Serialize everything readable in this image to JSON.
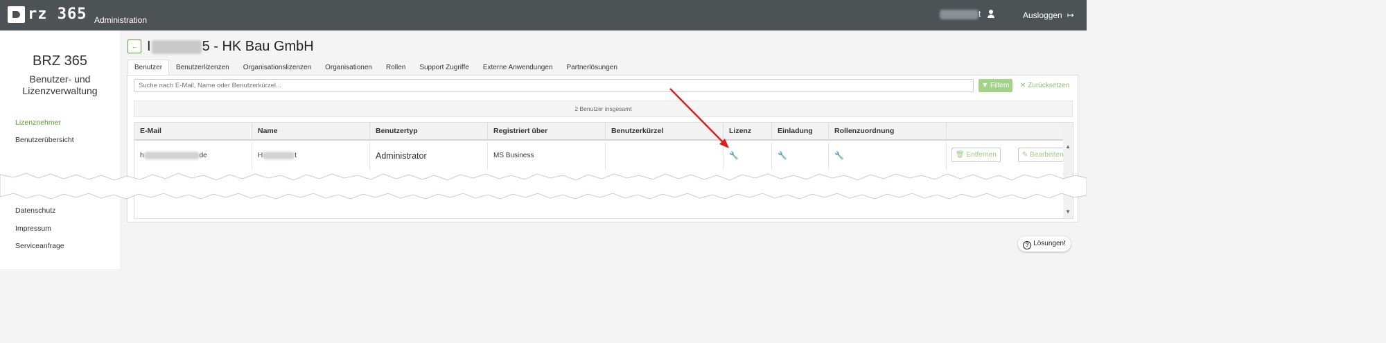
{
  "header": {
    "logo_text": "rz 365",
    "admin_label": "Administration",
    "user_suffix": "t",
    "logout_label": "Ausloggen",
    "logout_icon": "sign-out-icon"
  },
  "sidebar": {
    "title": "BRZ 365",
    "subtitle": "Benutzer- und Lizenzverwaltung",
    "items": [
      {
        "label": "Lizenznehmer",
        "active": true
      },
      {
        "label": "Benutzerübersicht",
        "active": false
      },
      {
        "label": "Datenschutz",
        "active": false
      },
      {
        "label": "Impressum",
        "active": false
      },
      {
        "label": "Serviceanfrage",
        "active": false
      }
    ]
  },
  "page": {
    "back_icon": "arrow-left-icon",
    "title_prefix": "I",
    "title_suffix": "5 - HK Bau GmbH"
  },
  "tabs": [
    {
      "label": "Benutzer",
      "active": true
    },
    {
      "label": "Benutzerlizenzen"
    },
    {
      "label": "Organisationslizenzen"
    },
    {
      "label": "Organisationen"
    },
    {
      "label": "Rollen"
    },
    {
      "label": "Support Zugriffe"
    },
    {
      "label": "Externe Anwendungen"
    },
    {
      "label": "Partnerlösungen"
    }
  ],
  "search": {
    "placeholder": "Suche nach E-Mail, Name oder Benutzerkürzel...",
    "filter_label": "Filtern",
    "reset_label": "Zurücksetzen"
  },
  "count_text": "2 Benutzer insgesamt",
  "table": {
    "columns": [
      "E-Mail",
      "Name",
      "Benutzertyp",
      "Registriert über",
      "Benutzerkürzel",
      "Lizenz",
      "Einladung",
      "Rollenzuordnung"
    ],
    "rows": [
      {
        "email_prefix": "h",
        "email_suffix": "de",
        "name_prefix": "H",
        "name_suffix": "t",
        "type": "Administrator",
        "registered": "MS Business",
        "short": "",
        "remove_label": "Entfernen",
        "edit_label": "Bearbeiten"
      }
    ]
  },
  "help_label": "Lösungen!",
  "colors": {
    "topbar": "#4d5255",
    "accent": "#5a9b32",
    "filter": "#a3d28a",
    "annotation_arrow": "#d81e1e"
  }
}
